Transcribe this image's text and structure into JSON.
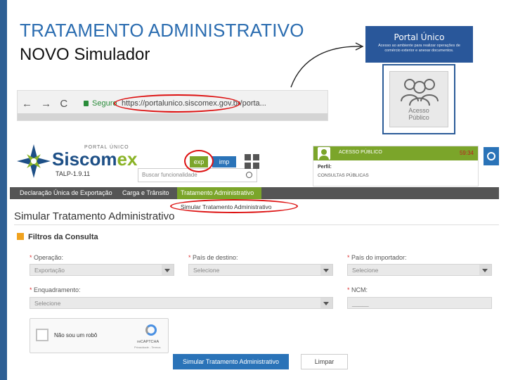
{
  "slide": {
    "title": "TRATAMENTO ADMINISTRATIVO",
    "subtitle": "NOVO Simulador"
  },
  "browser": {
    "nav": "← → C",
    "secure": "Seguro",
    "url": "https://portalunico.siscomex.gov.br/porta..."
  },
  "portal_card": {
    "title": "Portal Único",
    "description": "Acesso ao ambiente para realizar operações de comércio exterior e anexar documentos."
  },
  "access_card": {
    "line1": "Acesso",
    "line2": "Público"
  },
  "app": {
    "logo_top": "PORTAL ÚNICO",
    "logo_siscom": "Siscom",
    "logo_ex": "ex",
    "version": "TALP-1.9.11",
    "search_placeholder": "Buscar funcionalidade",
    "exp_label": "exp",
    "imp_label": "imp",
    "user": {
      "access_label": "ACESSO PÚBLICO",
      "timer": "59:34",
      "profile_label": "Perfil:",
      "profile_value": "CONSULTAS PÚBLICAS"
    },
    "menu": [
      "Declaração Única de Exportação",
      "Carga e Trânsito",
      "Tratamento Administrativo"
    ],
    "submenu": "Simular Tratamento Administrativo",
    "page_title": "Simular Tratamento Administrativo",
    "filters_title": "Filtros da Consulta",
    "fields": {
      "operacao_label": "Operação:",
      "operacao_value": "Exportação",
      "pais_destino_label": "País de destino:",
      "pais_destino_value": "Selecione",
      "pais_importador_label": "País do importador:",
      "pais_importador_value": "Selecione",
      "enquadramento_label": "Enquadramento:",
      "enquadramento_value": "Selecione",
      "ncm_label": "NCM:",
      "ncm_value": "_____"
    },
    "captcha": {
      "text": "Não sou um robô",
      "brand": "reCAPTCHA",
      "privacy": "Privacidade - Termos"
    },
    "simulate_button": "Simular Tratamento Administrativo",
    "clear_button": "Limpar"
  },
  "colors": {
    "accent_blue": "#2a73b8",
    "accent_green": "#7ba52a",
    "highlight_red": "#d11111"
  }
}
